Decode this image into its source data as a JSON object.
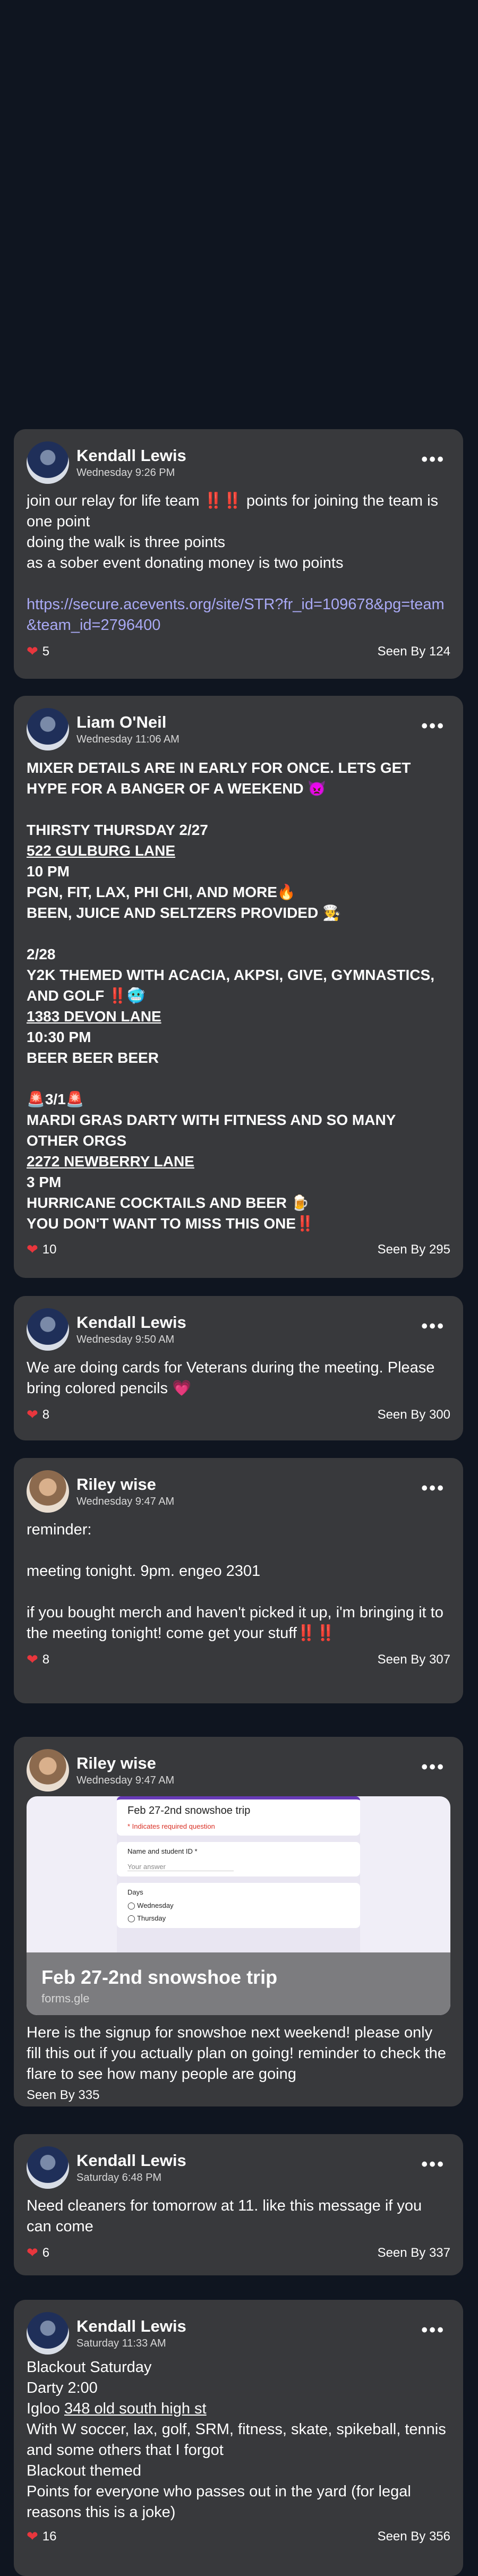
{
  "posts": [
    {
      "author": "Kendall Lewis",
      "time": "Wednesday 9:26 PM",
      "text": "join our relay for life team ",
      "text_marks": "‼️‼️",
      "text2": " points for joining the team is one point\ndoing the walk is three points\nas a sober event donating money is two points\n\n",
      "link": "https://secure.acevents.org/site/STR?fr_id=109678&pg=team&team_id=2796400",
      "likes": "5",
      "seen": "Seen By 124"
    },
    {
      "author": "Liam O'Neil",
      "time": "Wednesday 11:06 AM",
      "lines": [
        "MIXER DETAILS ARE IN EARLY FOR ONCE. LETS GET HYPE FOR A BANGER OF A WEEKEND 👿",
        "",
        "THIRSTY THURSDAY 2/27",
        "522 GULBURG LANE",
        "10 PM",
        "PGN, FIT, LAX, PHI CHI, AND MORE🔥",
        "BEEN, JUICE AND SELTZERS PROVIDED 🧑‍🍳",
        "",
        "2/28",
        "Y2K THEMED WITH ACACIA, AKPSI, GIVE, GYMNASTICS, AND GOLF ‼️🥶",
        "1383 DEVON LANE",
        "10:30 PM",
        "BEER BEER BEER",
        "",
        "🚨3/1🚨",
        "MARDI GRAS DARTY WITH FITNESS AND SO MANY OTHER ORGS",
        "2272 NEWBERRY LANE",
        "3 PM",
        "HURRICANE COCKTAILS AND BEER 🍺",
        "YOU DON'T WANT TO MISS THIS ONE‼️"
      ],
      "likes": "10",
      "seen": "Seen By 295"
    },
    {
      "author": "Kendall Lewis",
      "time": "Wednesday 9:50 AM",
      "text": "We are doing cards for Veterans during the meeting. Please bring colored pencils 💗",
      "likes": "8",
      "seen": "Seen By 300"
    },
    {
      "author": "Riley wise",
      "time": "Wednesday 9:47 AM",
      "text": "reminder:\n\nmeeting tonight. 9pm. engeo 2301\n\nif you bought merch and haven't picked it up, i'm bringing it to the meeting tonight! come get your stuff",
      "text_marks": "‼️‼️",
      "likes": "8",
      "seen": "Seen By 307"
    },
    {
      "author": "Riley wise",
      "time": "Wednesday 9:47 AM",
      "card_title": "Feb 27-2nd snowshoe trip",
      "card_host": "forms.gle",
      "form_title": "Feb 27-2nd snowshoe trip",
      "form_required": "* Indicates required question",
      "form_q1": "Name and student ID *",
      "form_q1_ph": "Your answer",
      "form_q2": "Days",
      "form_opt1": "Wednesday",
      "form_opt2": "Thursday",
      "text": "Here is the signup for snowshoe next weekend! please only fill this out if you actually plan on going! reminder to check the flare to see how many people are going",
      "seen": "Seen By 335"
    },
    {
      "author": "Kendall Lewis",
      "time": "Saturday 6:48 PM",
      "text": "Need cleaners for tomorrow at 11. like this message if you can come",
      "likes": "6",
      "seen": "Seen By 337"
    },
    {
      "author": "Kendall Lewis",
      "time": "Saturday 11:33 AM",
      "l1": "Blackout Saturday",
      "l2": "Darty 2:00",
      "l3a": "Igloo ",
      "l3b": "348 old south high st",
      "l4": "With W soccer, lax, golf, SRM, fitness, skate, spikeball, tennis and some others that I forgot",
      "l5": "Blackout themed",
      "l6": "Points for everyone who passes out in the yard (for legal reasons this is a joke)",
      "likes": "16",
      "seen": "Seen By 356"
    }
  ],
  "icons": {
    "menu": "more-horizontal-icon",
    "like": "heart-icon"
  },
  "colors": {
    "background": "#0f1520",
    "card": "#38393c",
    "link": "#a9a9f5",
    "heart": "#e8363d"
  }
}
